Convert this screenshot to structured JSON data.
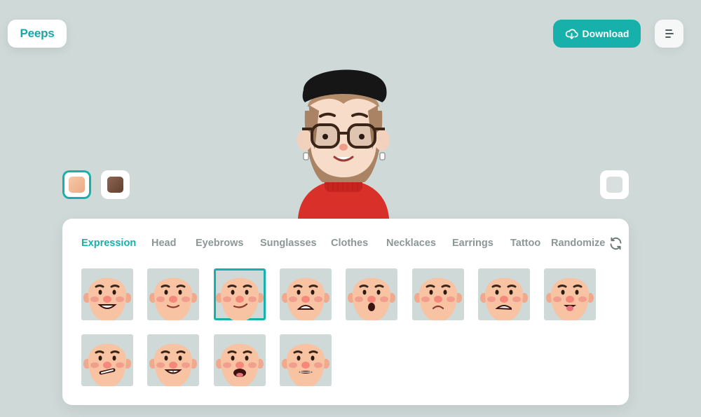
{
  "brand": {
    "logo_text": "Peeps"
  },
  "header": {
    "download_label": "Download"
  },
  "icons": {
    "download": "cloud-download-icon",
    "menu": "menu-icon",
    "randomize": "refresh-icon"
  },
  "colors": {
    "accent": "#17b0ab",
    "background": "#cfd9d8",
    "skin_light": "#f1b896",
    "skin_dark": "#7a5444"
  },
  "skin_tones": [
    {
      "name": "light",
      "selected": true
    },
    {
      "name": "dark",
      "selected": false
    }
  ],
  "tabs": [
    {
      "label": "Expression",
      "active": true
    },
    {
      "label": "Head",
      "active": false
    },
    {
      "label": "Eyebrows",
      "active": false
    },
    {
      "label": "Sunglasses",
      "active": false
    },
    {
      "label": "Clothes",
      "active": false
    },
    {
      "label": "Necklaces",
      "active": false
    },
    {
      "label": "Earrings",
      "active": false
    },
    {
      "label": "Tattoo",
      "active": false
    },
    {
      "label": "Randomize",
      "active": false
    }
  ],
  "expressions": [
    {
      "name": "big-grin",
      "selected": false
    },
    {
      "name": "smile",
      "selected": false
    },
    {
      "name": "smirk",
      "selected": true
    },
    {
      "name": "grimace",
      "selected": false
    },
    {
      "name": "surprised",
      "selected": false
    },
    {
      "name": "sad",
      "selected": false
    },
    {
      "name": "teeth-frown",
      "selected": false
    },
    {
      "name": "tongue-out",
      "selected": false
    },
    {
      "name": "crooked-grin",
      "selected": false
    },
    {
      "name": "toothy-grin",
      "selected": false
    },
    {
      "name": "tongue-open",
      "selected": false
    },
    {
      "name": "tight-lips",
      "selected": false
    }
  ]
}
